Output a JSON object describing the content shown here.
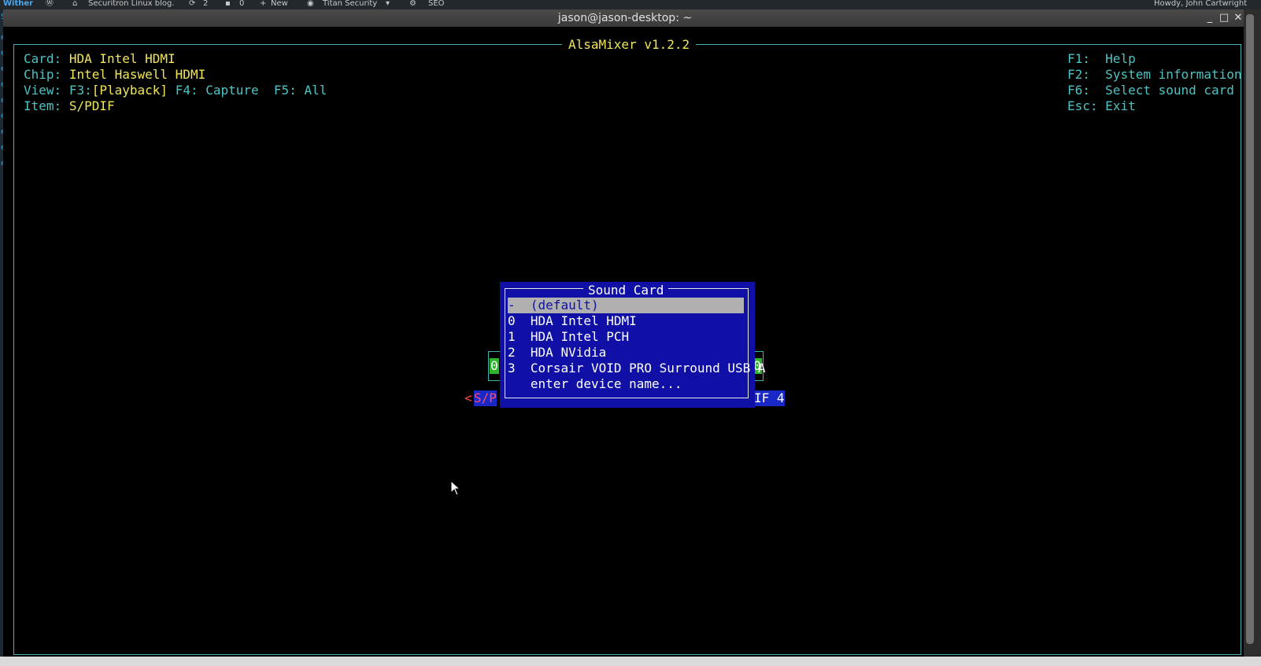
{
  "wp_admin_bar": {
    "left_fragment": "Wither",
    "site_name": "Securitron Linux blog.",
    "updates_count": "2",
    "comments_count": "0",
    "new_label": "New",
    "titan_label": "Titan Security",
    "seo_label": "SEO",
    "howdy": "Howdy, John Cartwright"
  },
  "window": {
    "title": "jason@jason-desktop: ~",
    "minimize": "_",
    "maximize": "□",
    "close": "✕"
  },
  "alsamixer": {
    "title": "AlsaMixer v1.2.2",
    "card_label": "Card:",
    "card_value": "HDA Intel HDMI",
    "chip_label": "Chip:",
    "chip_value": "Intel Haswell HDMI",
    "view_label": "View:",
    "view_f3_key": "F3:",
    "view_f3_value": "[Playback]",
    "view_f4": "F4: Capture",
    "view_f5": "F5: All",
    "item_label": "Item:",
    "item_value": "S/PDIF",
    "help": [
      {
        "key": "F1:",
        "text": "Help"
      },
      {
        "key": "F2:",
        "text": "System information"
      },
      {
        "key": "F6:",
        "text": "Select sound card"
      },
      {
        "key": "Esc:",
        "text": "Exit"
      }
    ],
    "control_left_value": "0",
    "control_right_value": "0",
    "control_label_left_arrow": "<",
    "control_label_left": "S/P",
    "control_label_right": "IF 4"
  },
  "sound_card_dialog": {
    "title": "Sound Card",
    "options": [
      {
        "index": "-",
        "name": "(default)"
      },
      {
        "index": "0",
        "name": "HDA Intel HDMI"
      },
      {
        "index": "1",
        "name": "HDA Intel PCH"
      },
      {
        "index": "2",
        "name": "HDA NVidia"
      },
      {
        "index": "3",
        "name": "Corsair VOID PRO Surround USB A"
      },
      {
        "index": " ",
        "name": "enter device name..."
      }
    ],
    "selected_index": 0
  },
  "colors": {
    "cyan": "#4fc2c2",
    "yellow": "#f0e65a",
    "dialog_blue": "#1010a6",
    "selection_gray": "#b0b0b0",
    "meter_green": "#2bb52b"
  }
}
